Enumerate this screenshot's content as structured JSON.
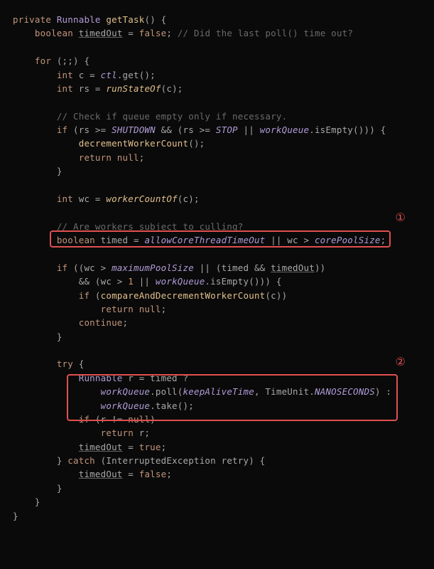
{
  "code": {
    "line1_private": "private",
    "line1_type": "Runnable",
    "line1_name": "getTask",
    "line1_rest": "() {",
    "line2_kw": "boolean",
    "line2_var": "timedOut",
    "line2_eq": " = ",
    "line2_val": "false",
    "line2_semi": ";",
    "line2_comment": " // Did the last poll() time out?",
    "line4_for": "for",
    "line4_rest": " (;;) {",
    "line5_int": "int",
    "line5_c": " c = ",
    "line5_ctl": "ctl",
    "line5_get": ".get();",
    "line6_int": "int",
    "line6_rs": " rs = ",
    "line6_fn": "runStateOf",
    "line6_rest": "(c);",
    "line8_comment": "// Check if queue empty only if necessary.",
    "line9_if": "if",
    "line9_open": " (rs >= ",
    "line9_shutdown": "SHUTDOWN",
    "line9_and": " && (rs >= ",
    "line9_stop": "STOP",
    "line9_or": " || ",
    "line9_wq": "workQueue",
    "line9_rest": ".isEmpty())) {",
    "line10_fn": "decrementWorkerCount",
    "line10_rest": "();",
    "line11_return": "return null",
    "line11_semi": ";",
    "line12_brace": "}",
    "line14_int": "int",
    "line14_wc": " wc = ",
    "line14_fn": "workerCountOf",
    "line14_rest": "(c);",
    "line16_comment": "// Are workers subject to culling?",
    "line17_bool": "boolean",
    "line17_timed": " timed = ",
    "line17_allow": "allowCoreThreadTimeOut",
    "line17_or": " || wc > ",
    "line17_core": "corePoolSize",
    "line17_semi": ";",
    "line19_if": "if",
    "line19_open": " ((wc > ",
    "line19_max": "maximumPoolSize",
    "line19_or1": " || (timed && ",
    "line19_to": "timedOut",
    "line19_close": "))",
    "line20_and": "&& (wc > ",
    "line20_one": "1",
    "line20_or": " || ",
    "line20_wq": "workQueue",
    "line20_rest": ".isEmpty())) {",
    "line21_if": "if",
    "line21_open": " (",
    "line21_fn": "compareAndDecrementWorkerCount",
    "line21_rest": "(c))",
    "line22_return": "return null",
    "line22_semi": ";",
    "line23_cont": "continue",
    "line23_semi": ";",
    "line24_brace": "}",
    "line26_try": "try",
    "line26_brace": " {",
    "line27_type": "Runnable",
    "line27_r": " r = timed ?",
    "line28_wq": "workQueue",
    "line28_poll": ".poll(",
    "line28_kat": "keepAliveTime",
    "line28_comma": ", TimeUnit.",
    "line28_nano": "NANOSECONDS",
    "line28_rest": ") :",
    "line29_wq": "workQueue",
    "line29_rest": ".take();",
    "line30_if": "if",
    "line30_cond": " (r != ",
    "line30_null": "null",
    "line30_close": ")",
    "line31_return": "return",
    "line31_r": " r;",
    "line32_to": "timedOut",
    "line32_eq": " = ",
    "line32_true": "true",
    "line32_semi": ";",
    "line33_catch": "} ",
    "line33_catchkw": "catch",
    "line33_open": " (InterruptedException retry) {",
    "line34_to": "timedOut",
    "line34_eq": " = ",
    "line34_false": "false",
    "line34_semi": ";",
    "line35_brace": "}",
    "line36_brace": "}",
    "line37_brace": "}"
  },
  "annotations": {
    "marker1": "①",
    "marker2": "②"
  }
}
